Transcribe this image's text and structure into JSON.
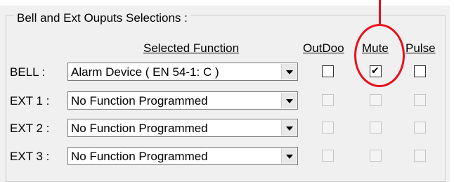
{
  "group": {
    "title": "Bell and Ext Ouputs Selections :"
  },
  "columns": {
    "function": "Selected Function",
    "outdoor": "OutDoo",
    "mute": "Mute",
    "pulse": "Pulse"
  },
  "rows": [
    {
      "label": "BELL :",
      "function": "Alarm Device ( EN 54-1: C )",
      "outdoor": false,
      "mute": true,
      "pulse": false,
      "enabled": true
    },
    {
      "label": "EXT 1 :",
      "function": "No Function Programmed",
      "outdoor": false,
      "mute": false,
      "pulse": false,
      "enabled": false
    },
    {
      "label": "EXT 2 :",
      "function": "No Function Programmed",
      "outdoor": false,
      "mute": false,
      "pulse": false,
      "enabled": false
    },
    {
      "label": "EXT 3 :",
      "function": "No Function Programmed",
      "outdoor": false,
      "mute": false,
      "pulse": false,
      "enabled": false
    }
  ],
  "icons": {
    "dropdown": "chevron-down-icon",
    "check": "checkmark-icon"
  },
  "annotation": {
    "color": "#e8101c",
    "target": "mute-checkbox-bell"
  }
}
